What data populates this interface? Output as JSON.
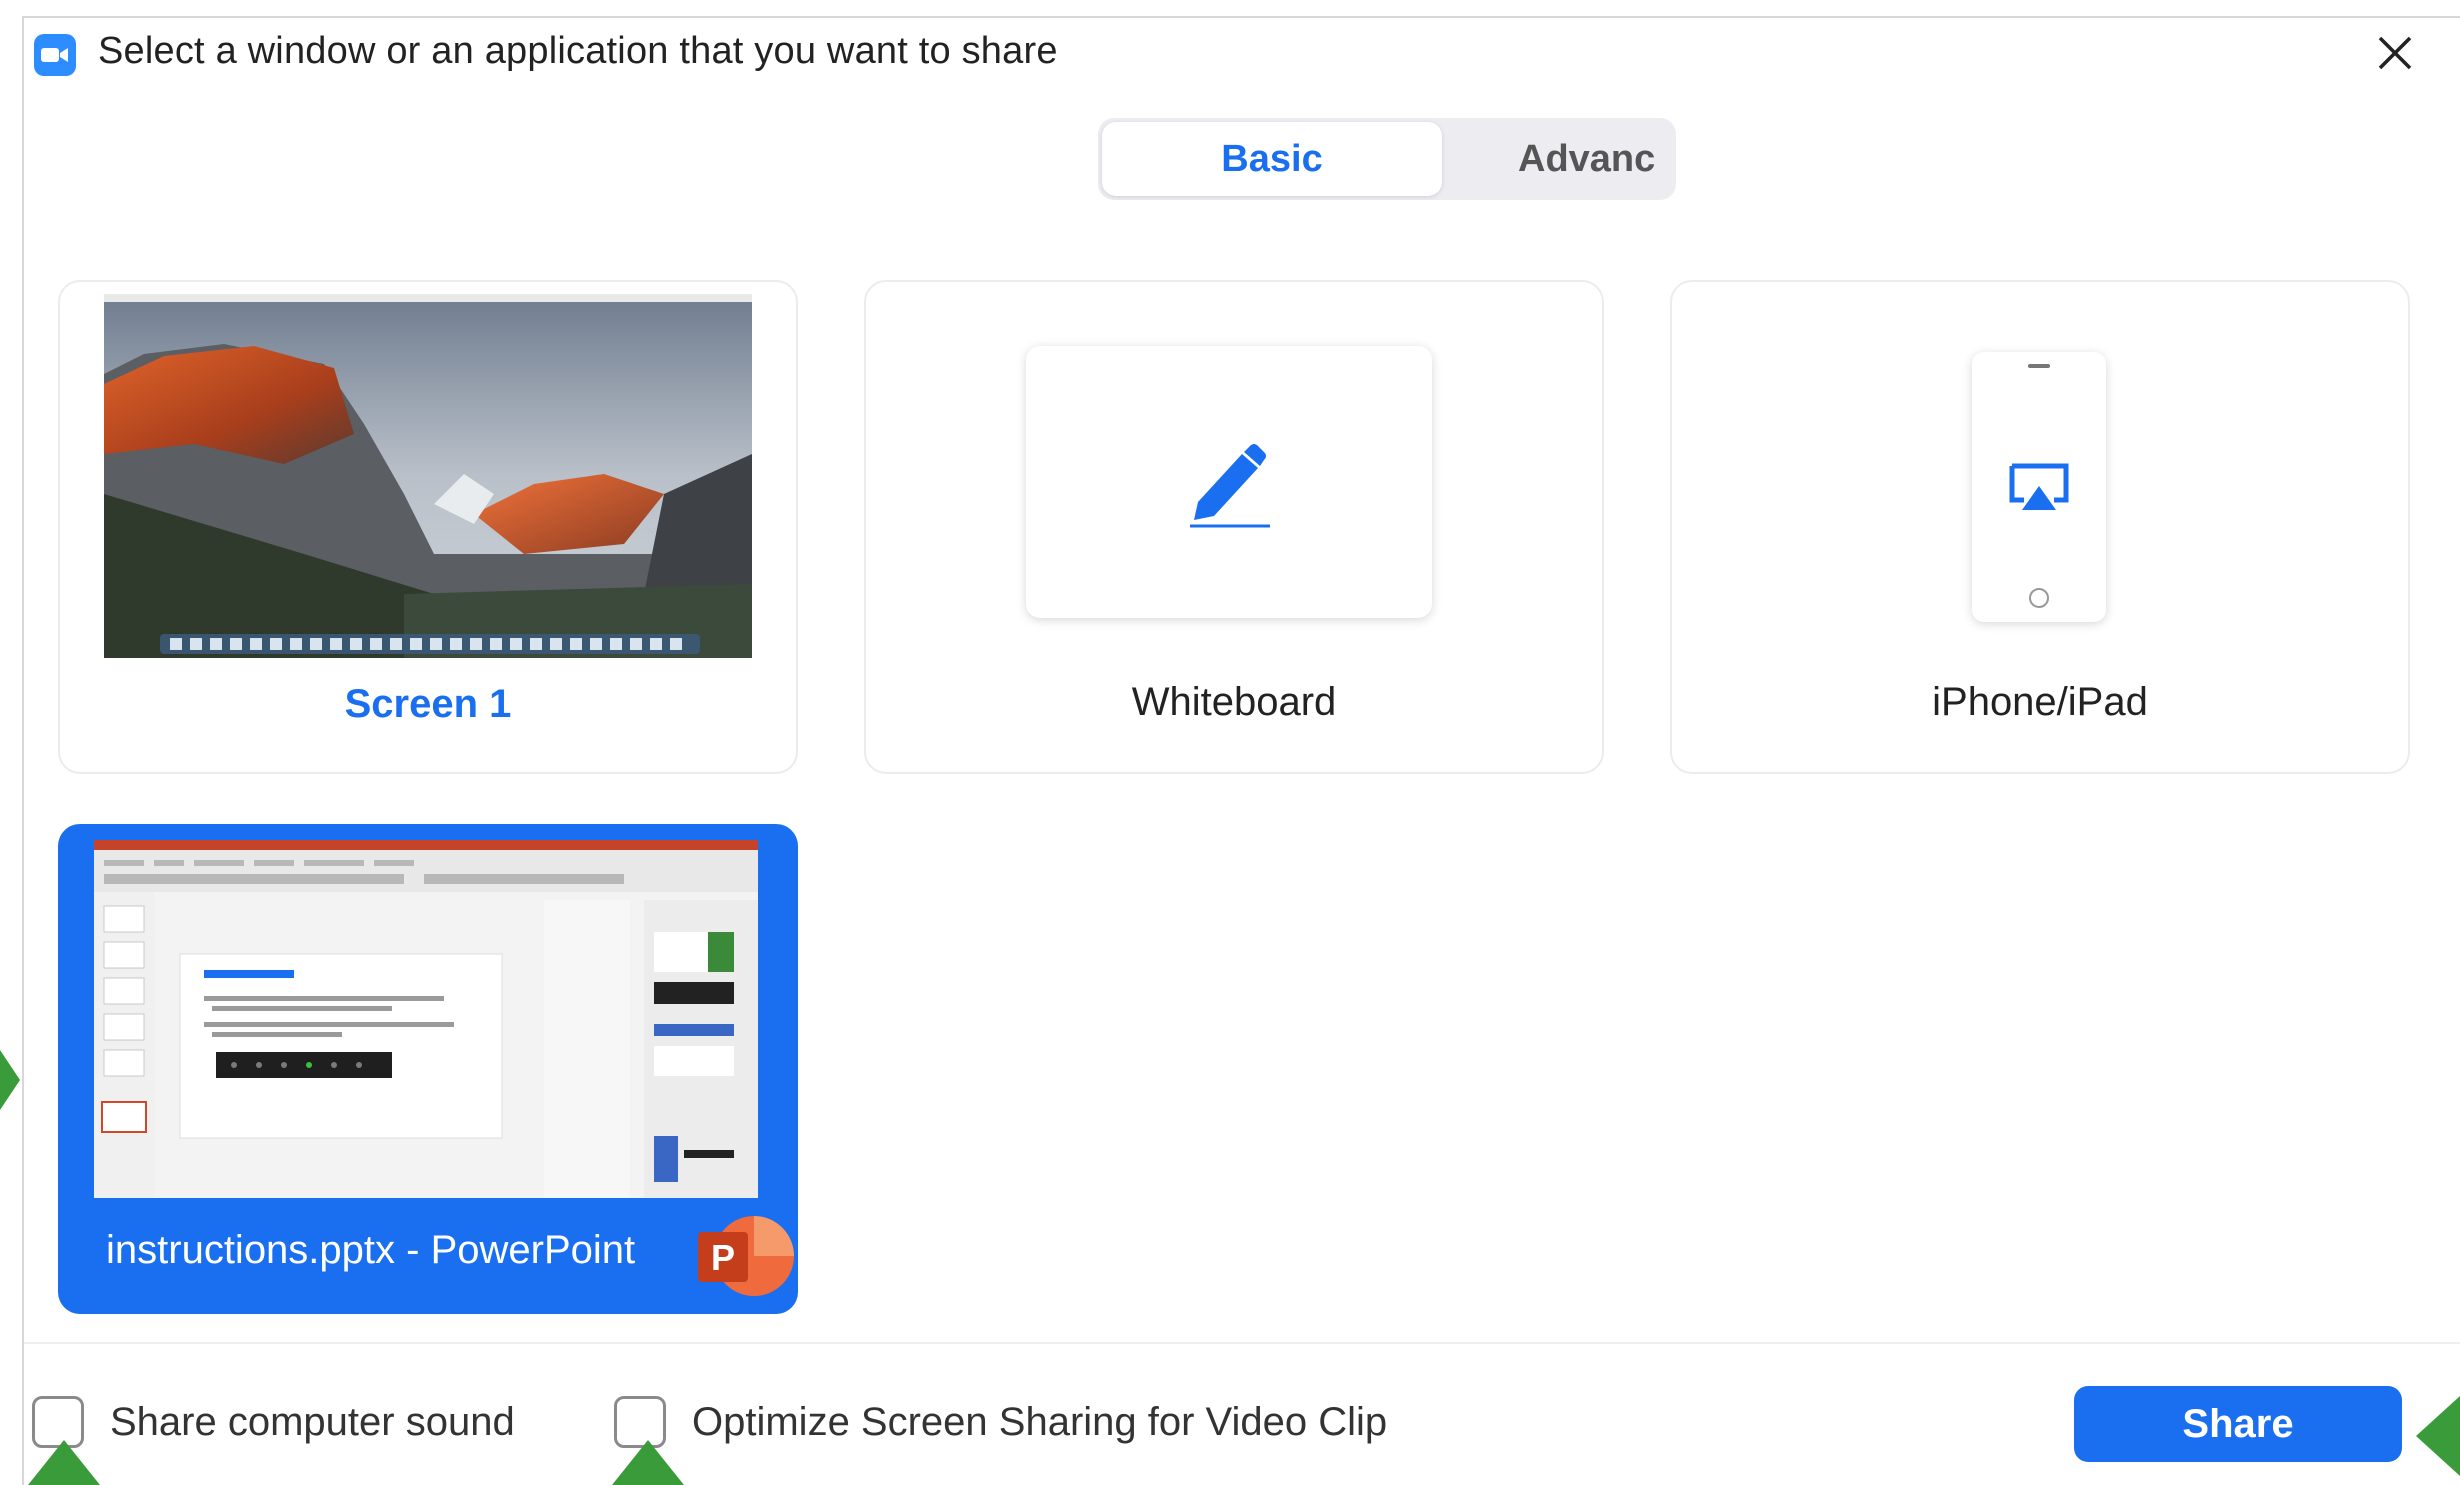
{
  "window": {
    "title": "Select a window or an application that you want to share",
    "close_icon": "close-icon",
    "app_icon": "zoom-camera-icon"
  },
  "tabs": [
    {
      "label": "Basic",
      "selected": true
    },
    {
      "label": "Advanc",
      "selected": false
    }
  ],
  "sources": [
    {
      "label": "Screen 1",
      "thumbnail": "desktop-mountain-wallpaper",
      "selected": false
    },
    {
      "label": "Whiteboard",
      "icon": "pencil-icon",
      "selected": false
    },
    {
      "label": "iPhone/iPad",
      "icon": "airplay-icon",
      "selected": false
    },
    {
      "label": "instructions.pptx - PowerPoint",
      "icon": "powerpoint-icon",
      "app_icon_letter": "P",
      "selected": true
    }
  ],
  "options": {
    "share_sound": {
      "label": "Share computer sound",
      "checked": false
    },
    "optimize_video": {
      "label": "Optimize Screen Sharing for Video Clip",
      "checked": false
    }
  },
  "actions": {
    "share_label": "Share"
  },
  "colors": {
    "accent": "#1a6ff0",
    "marker": "#3a9b3a",
    "powerpoint": "#d24726"
  }
}
